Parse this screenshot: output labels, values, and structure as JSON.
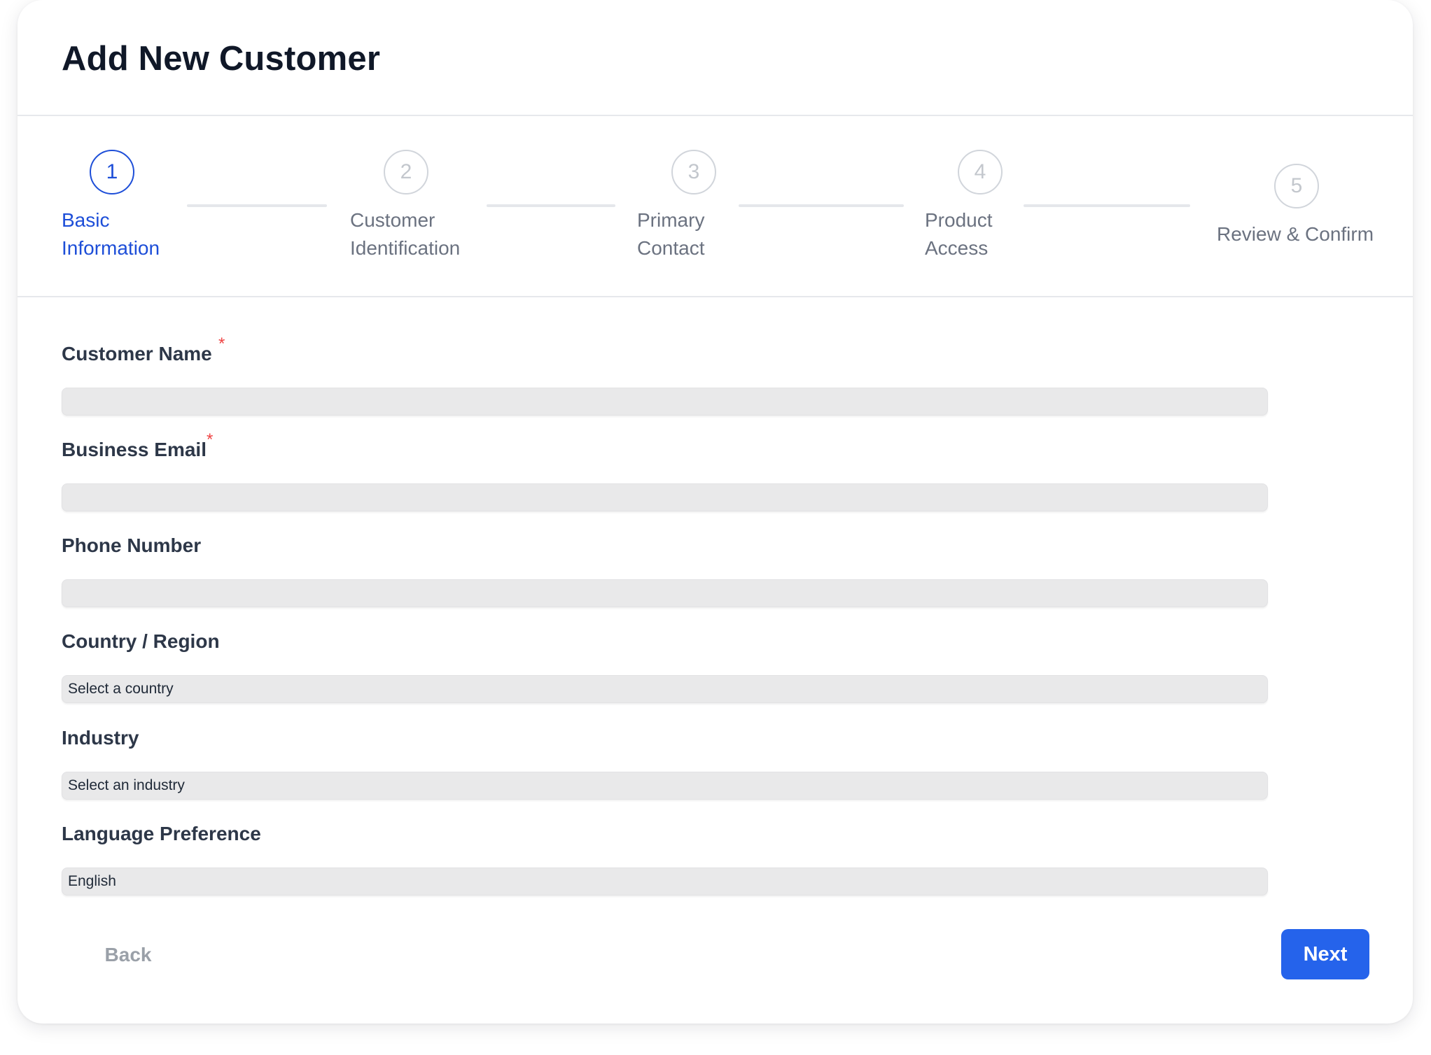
{
  "page": {
    "title": "Add New Customer"
  },
  "stepper": {
    "current_step": 1,
    "steps": [
      {
        "number": "1",
        "label_line1": "Basic",
        "label_line2": "Information",
        "active": true
      },
      {
        "number": "2",
        "label_line1": "Customer",
        "label_line2": "Identification",
        "active": false
      },
      {
        "number": "3",
        "label_line1": "Primary",
        "label_line2": "Contact",
        "active": false
      },
      {
        "number": "4",
        "label_line1": "Product",
        "label_line2": "Access",
        "active": false
      },
      {
        "number": "5",
        "label_line1": "Review & Confirm",
        "label_line2": "",
        "active": false
      }
    ]
  },
  "form": {
    "customer_name": {
      "label": "Customer Name",
      "required_mark": "*",
      "value": ""
    },
    "business_email": {
      "label": "Business Email",
      "required_mark": "*",
      "value": ""
    },
    "phone_number": {
      "label": "Phone Number",
      "value": ""
    },
    "country_region": {
      "label": "Country / Region",
      "selected": "Select a country"
    },
    "industry": {
      "label": "Industry",
      "selected": "Select an industry"
    },
    "language_preference": {
      "label": "Language Preference",
      "selected": "English"
    }
  },
  "actions": {
    "back_label": "Back",
    "next_label": "Next"
  },
  "colors": {
    "accent": "#2563eb",
    "active_step": "#1d4ed8",
    "required": "#ef4444",
    "input_bg": "#e9e9ea",
    "inactive_text": "#6b7280"
  }
}
